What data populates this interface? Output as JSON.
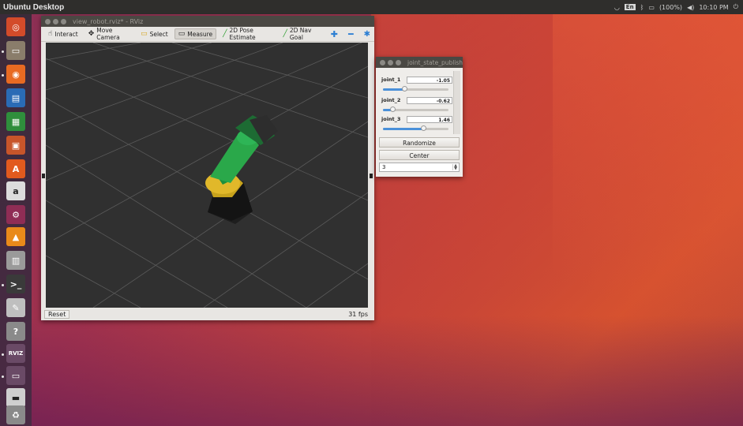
{
  "desktop": {
    "title": "Ubuntu Desktop"
  },
  "tray": {
    "lang": "En",
    "battery": "(100%)",
    "time": "10:10 PM"
  },
  "launcher": {
    "items": [
      {
        "name": "ubuntu-dash-icon",
        "color": "#d34b2a",
        "glyph": "◎"
      },
      {
        "name": "files-icon",
        "color": "#8a7d6b",
        "glyph": "▭"
      },
      {
        "name": "firefox-icon",
        "color": "#e86a22",
        "glyph": "◉"
      },
      {
        "name": "writer-icon",
        "color": "#2a6bb5",
        "glyph": "▤"
      },
      {
        "name": "calc-icon",
        "color": "#2f8e3c",
        "glyph": "▦"
      },
      {
        "name": "impress-icon",
        "color": "#c8552a",
        "glyph": "▣"
      },
      {
        "name": "software-center-icon",
        "color": "#e25a1e",
        "glyph": "A"
      },
      {
        "name": "amazon-icon",
        "color": "#dcdcdc",
        "glyph": "a"
      },
      {
        "name": "settings-icon",
        "color": "#8f2d55",
        "glyph": "⚙"
      },
      {
        "name": "vlc-icon",
        "color": "#e98a1a",
        "glyph": "▲"
      },
      {
        "name": "printer-icon",
        "color": "#9a9a9a",
        "glyph": "▥"
      },
      {
        "name": "terminal-icon",
        "color": "#3a3a3a",
        "glyph": ">_"
      },
      {
        "name": "editor-icon",
        "color": "#bfbfbf",
        "glyph": "✎"
      },
      {
        "name": "help-icon",
        "color": "#8a8a8a",
        "glyph": "?"
      },
      {
        "name": "rviz-icon",
        "color": "#6a4a66",
        "glyph": "RVIZ"
      },
      {
        "name": "window-icon",
        "color": "#6a4a66",
        "glyph": "▭"
      },
      {
        "name": "drive-icon",
        "color": "#cfcfcf",
        "glyph": "▬"
      },
      {
        "name": "trash-icon",
        "color": "#8a8a8a",
        "glyph": "♻"
      }
    ]
  },
  "rviz": {
    "title": "view_robot.rviz* - RViz",
    "tools": [
      {
        "icon": "hand-icon",
        "glyph": "☝",
        "label": "Interact"
      },
      {
        "icon": "move-camera-icon",
        "glyph": "✥",
        "label": "Move Camera"
      },
      {
        "icon": "select-icon",
        "glyph": "▭",
        "label": "Select"
      },
      {
        "icon": "measure-icon",
        "glyph": "▭",
        "label": "Measure"
      },
      {
        "icon": "pose-estimate-icon",
        "glyph": "╱",
        "label": "2D Pose Estimate"
      },
      {
        "icon": "nav-goal-icon",
        "glyph": "╱",
        "label": "2D Nav Goal"
      }
    ],
    "reset_label": "Reset",
    "fps": "31 fps"
  },
  "jsp": {
    "title": "joint_state_publishe",
    "joints": [
      {
        "label": "joint_1",
        "value": "-1.05",
        "fraction": 0.33
      },
      {
        "label": "joint_2",
        "value": "-0.62",
        "fraction": 0.15
      },
      {
        "label": "joint_3",
        "value": "1.46",
        "fraction": 0.62
      }
    ],
    "randomize_label": "Randomize",
    "center_label": "Center",
    "spin_value": "3"
  }
}
